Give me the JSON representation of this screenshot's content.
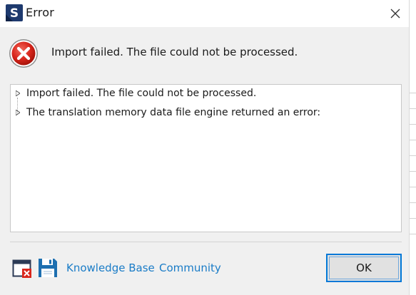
{
  "window": {
    "title": "Error",
    "app_icon_letter": "S",
    "icons": {
      "app": "trados-s-icon",
      "close": "close-icon"
    }
  },
  "header": {
    "icon": "error-x-icon",
    "message": "Import failed. The file could not be processed."
  },
  "details": {
    "items": [
      {
        "text": "Import failed. The file could not be processed.",
        "expanded": false
      },
      {
        "text": "The translation memory data file engine returned an error:",
        "expanded": false
      }
    ]
  },
  "footer": {
    "icons": [
      "close-window-icon",
      "save-icon"
    ],
    "links": {
      "knowledge_base": "Knowledge Base",
      "community": "Community"
    },
    "ok_label": "OK"
  },
  "colors": {
    "link": "#1a7cc7",
    "accent": "#0078d7",
    "error": "#d9261c",
    "app_icon_bg": "#1e3a6e"
  }
}
